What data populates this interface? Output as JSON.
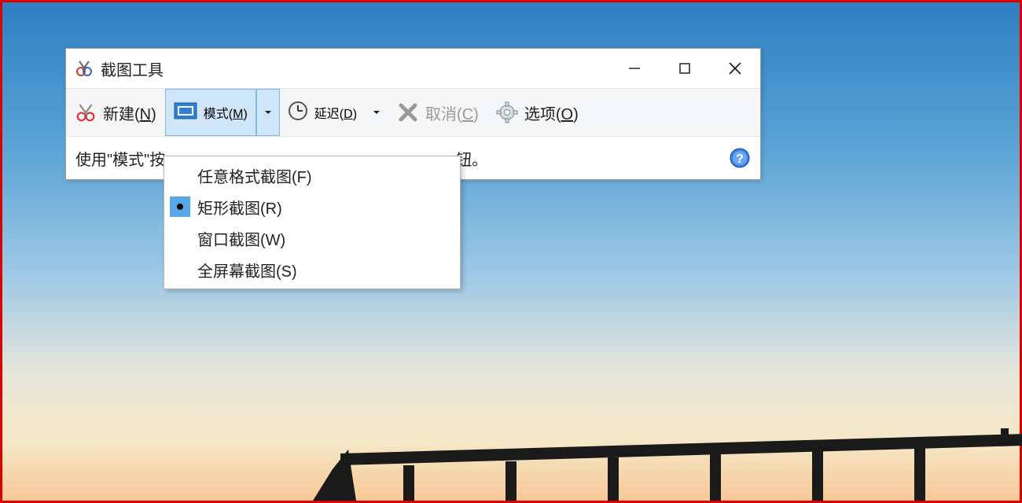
{
  "window": {
    "title": "截图工具"
  },
  "toolbar": {
    "new_label_prefix": "新建(",
    "new_hotkey": "N",
    "new_label_suffix": ")",
    "mode_label_prefix": "模式(",
    "mode_hotkey": "M",
    "mode_label_suffix": ")",
    "delay_label_prefix": "延迟(",
    "delay_hotkey": "D",
    "delay_label_suffix": ")",
    "cancel_label_prefix": "取消(",
    "cancel_hotkey": "C",
    "cancel_label_suffix": ")",
    "options_label_prefix": "选项(",
    "options_hotkey": "O",
    "options_label_suffix": ")"
  },
  "hint": {
    "text_left": "使用\"模式\"按",
    "text_right": "钮。"
  },
  "mode_menu": {
    "items": [
      {
        "label": "任意格式截图(F)",
        "selected": false
      },
      {
        "label": "矩形截图(R)",
        "selected": true
      },
      {
        "label": "窗口截图(W)",
        "selected": false
      },
      {
        "label": "全屏幕截图(S)",
        "selected": false
      }
    ]
  }
}
